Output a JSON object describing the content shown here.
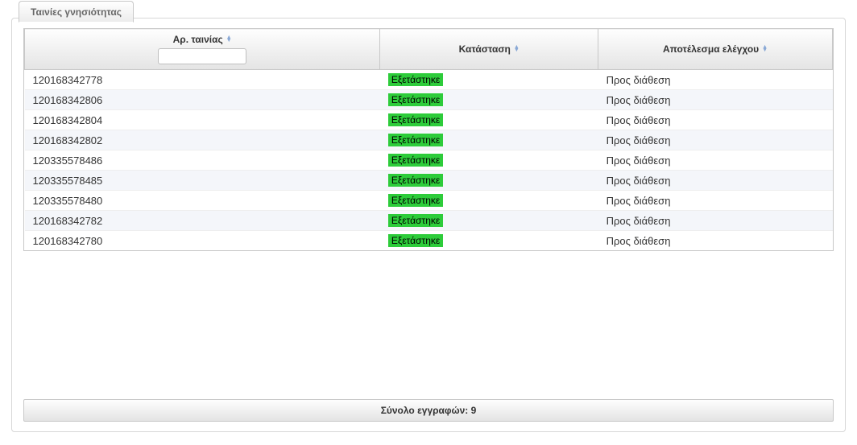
{
  "tab_label": "Ταινίες γνησιότητας",
  "columns": {
    "col1": "Αρ. ταινίας",
    "col2": "Κατάσταση",
    "col3": "Αποτέλεσμα ελέγχου"
  },
  "filter_value": "",
  "rows": [
    {
      "id": "120168342778",
      "status": "Εξετάστηκε",
      "result": "Προς διάθεση"
    },
    {
      "id": "120168342806",
      "status": "Εξετάστηκε",
      "result": "Προς διάθεση"
    },
    {
      "id": "120168342804",
      "status": "Εξετάστηκε",
      "result": "Προς διάθεση"
    },
    {
      "id": "120168342802",
      "status": "Εξετάστηκε",
      "result": "Προς διάθεση"
    },
    {
      "id": "120335578486",
      "status": "Εξετάστηκε",
      "result": "Προς διάθεση"
    },
    {
      "id": "120335578485",
      "status": "Εξετάστηκε",
      "result": "Προς διάθεση"
    },
    {
      "id": "120335578480",
      "status": "Εξετάστηκε",
      "result": "Προς διάθεση"
    },
    {
      "id": "120168342782",
      "status": "Εξετάστηκε",
      "result": "Προς διάθεση"
    },
    {
      "id": "120168342780",
      "status": "Εξετάστηκε",
      "result": "Προς διάθεση"
    }
  ],
  "totals_label": "Σύνολο εγγραφών: 9"
}
